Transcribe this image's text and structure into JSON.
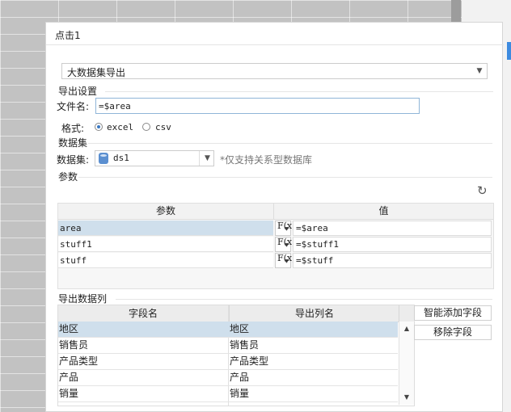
{
  "dialog": {
    "title": "点击1"
  },
  "export_type": {
    "selected": "大数据集导出"
  },
  "export_settings": {
    "section_label": "导出设置",
    "filename_label": "文件名:",
    "filename_value": "=$area",
    "format_label": "格式:",
    "format_options": [
      {
        "label": "excel",
        "selected": true
      },
      {
        "label": "csv",
        "selected": false
      }
    ]
  },
  "dataset": {
    "section_label": "数据集",
    "field_label": "数据集:",
    "selected": "ds1",
    "note": "*仅支持关系型数据库"
  },
  "params": {
    "section_label": "参数",
    "columns": [
      "参数",
      "值"
    ],
    "rows": [
      {
        "name": "area",
        "fx": "F(x)",
        "value": "=$area",
        "selected": true
      },
      {
        "name": "stuff1",
        "fx": "F(x)",
        "value": "=$stuff1",
        "selected": false
      },
      {
        "name": "stuff",
        "fx": "F(x)",
        "value": "=$stuff",
        "selected": false
      }
    ]
  },
  "export_columns": {
    "section_label": "导出数据列",
    "columns": [
      "字段名",
      "导出列名"
    ],
    "rows": [
      {
        "field": "地区",
        "export": "地区",
        "selected": true
      },
      {
        "field": "销售员",
        "export": "销售员",
        "selected": false
      },
      {
        "field": "产品类型",
        "export": "产品类型",
        "selected": false
      },
      {
        "field": "产品",
        "export": "产品",
        "selected": false
      },
      {
        "field": "销量",
        "export": "销量",
        "selected": false
      }
    ],
    "add_button": "智能添加字段",
    "remove_button": "移除字段"
  }
}
